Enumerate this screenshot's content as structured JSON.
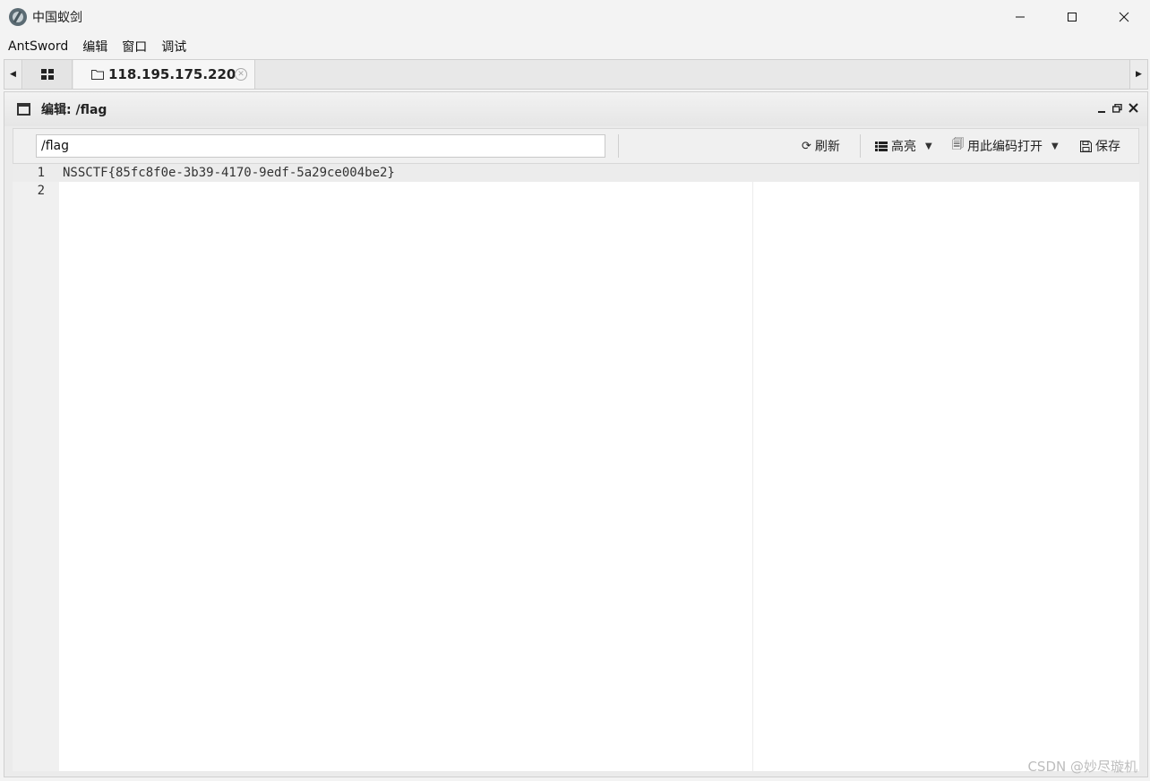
{
  "window": {
    "title": "中国蚁剑",
    "icon": "antsword-logo",
    "controls": {
      "minimize": "—",
      "maximize": "☐",
      "close": "✕"
    }
  },
  "menubar": {
    "items": [
      "AntSword",
      "编辑",
      "窗口",
      "调试"
    ]
  },
  "tabs": {
    "home_icon": "grid-icon",
    "active_label": "118.195.175.220",
    "active_icon": "folder-icon"
  },
  "panel": {
    "title": "编辑: /flag"
  },
  "toolbar": {
    "path_value": "/flag",
    "refresh_label": "刷新",
    "highlight_label": "高亮",
    "encoding_label": "用此编码打开",
    "save_label": "保存"
  },
  "editor": {
    "lines": [
      {
        "num": "1",
        "text": "NSSCTF{85fc8f0e-3b39-4170-9edf-5a29ce004be2}"
      },
      {
        "num": "2",
        "text": ""
      }
    ]
  },
  "watermark": "CSDN @妙尽璇机"
}
